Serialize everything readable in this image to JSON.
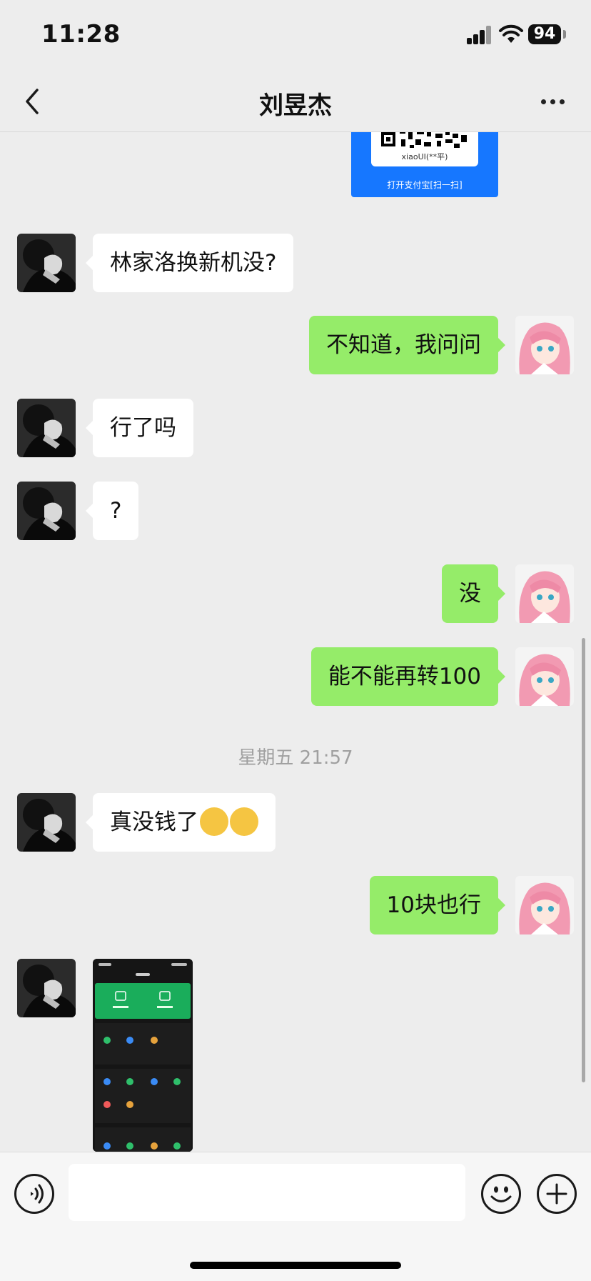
{
  "status_bar": {
    "time": "11:28",
    "battery": "94"
  },
  "nav": {
    "title": "刘昱杰"
  },
  "qr_card": {
    "name": "xiaoUI(**平)",
    "footer": "打开支付宝[扫一扫]"
  },
  "messages": {
    "m1": "林家洛换新机没?",
    "m2": "不知道，我问问",
    "m3": "行了吗",
    "m4": "?",
    "m5": "没",
    "m6": "能不能再转100",
    "timestamp": "星期五 21:57",
    "m7": "真没钱了",
    "m8": "10块也行"
  },
  "colors": {
    "outgoing_bubble": "#95ec69",
    "incoming_bubble": "#ffffff",
    "qr_card": "#1677ff",
    "background": "#ededed"
  }
}
